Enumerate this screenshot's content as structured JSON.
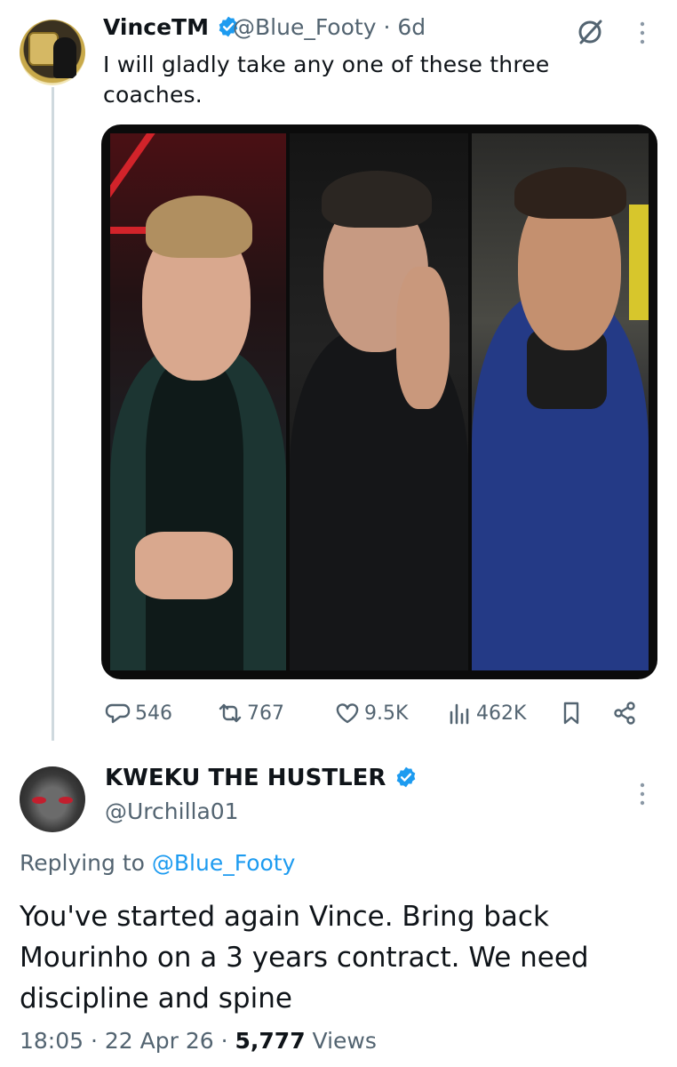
{
  "tweet": {
    "author_name": "VinceTM",
    "handle": "@Blue_Footy",
    "time": "· 6d",
    "text": "I will gladly take any one of these three coaches.",
    "stats": {
      "replies": "546",
      "reposts": "767",
      "likes": "9.5K",
      "views": "462K"
    }
  },
  "reply": {
    "author_name": "KWEKU THE HUSTLER",
    "handle": "@Urchilla01",
    "replying_prefix": "Replying to",
    "replying_to": "@Blue_Footy",
    "text": "You've started again Vince. Bring back Mourinho on a 3 years contract. We need discipline and spine",
    "time": "18:05",
    "date": "· 22 Apr 26 ·",
    "views_count": "5,777",
    "views_label": "Views"
  },
  "icons": [
    "verified-badge-icon",
    "grok-icon",
    "more-icon",
    "reply-icon",
    "repost-icon",
    "like-icon",
    "views-icon",
    "bookmark-icon",
    "share-icon"
  ],
  "colors": {
    "accent": "#1d9bf0",
    "secondary_text": "#536471",
    "primary_text": "#0f1419"
  }
}
